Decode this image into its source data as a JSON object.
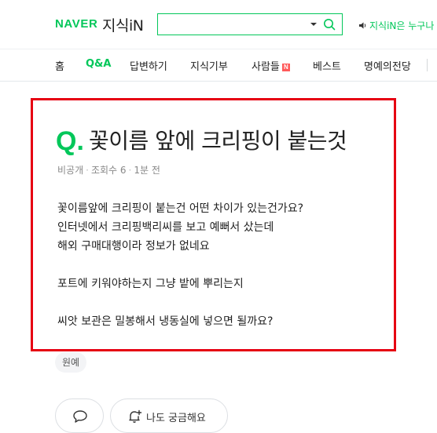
{
  "header": {
    "brand": "NAVER",
    "service": "지식iN",
    "search": {
      "value": "",
      "placeholder": ""
    },
    "icons": {
      "dropdown": "caret-down-icon",
      "search": "search-icon",
      "promo": "speaker-icon"
    },
    "promo_text": "지식iN은 누구나"
  },
  "nav": {
    "items": [
      {
        "label": "홈"
      },
      {
        "label": "Q&A",
        "active": true
      },
      {
        "label": "답변하기"
      },
      {
        "label": "지식기부"
      },
      {
        "label": "사람들",
        "badge": "N"
      },
      {
        "label": "베스트"
      },
      {
        "label": "명예의전당"
      }
    ]
  },
  "question": {
    "q_mark": "Q.",
    "title": "꽃이름 앞에 크리핑이 붙는것",
    "meta": {
      "author": "비공개",
      "views": "조회수 6",
      "time": "1분 전"
    },
    "body": [
      "꽃이름앞에 크리핑이 붙는건 어떤 차이가 있는건가요?",
      "인터넷에서 크리핑백리씨를 보고 예뻐서 샀는데",
      "해외 구매대행이라 정보가 없네요",
      "포트에 키워야하는지 그냥 밭에 뿌리는지",
      "씨앗 보관은 밀봉해서 냉동실에 넣으면 될까요?"
    ],
    "tag": "원예"
  },
  "actions": {
    "comment_icon": "comment-icon",
    "curious_icon": "bell-plus-icon",
    "curious_label": "나도 궁금해요"
  },
  "colors": {
    "brand": "#03c75a",
    "highlight_border": "#e60012",
    "badge": "#ff5a5a"
  }
}
